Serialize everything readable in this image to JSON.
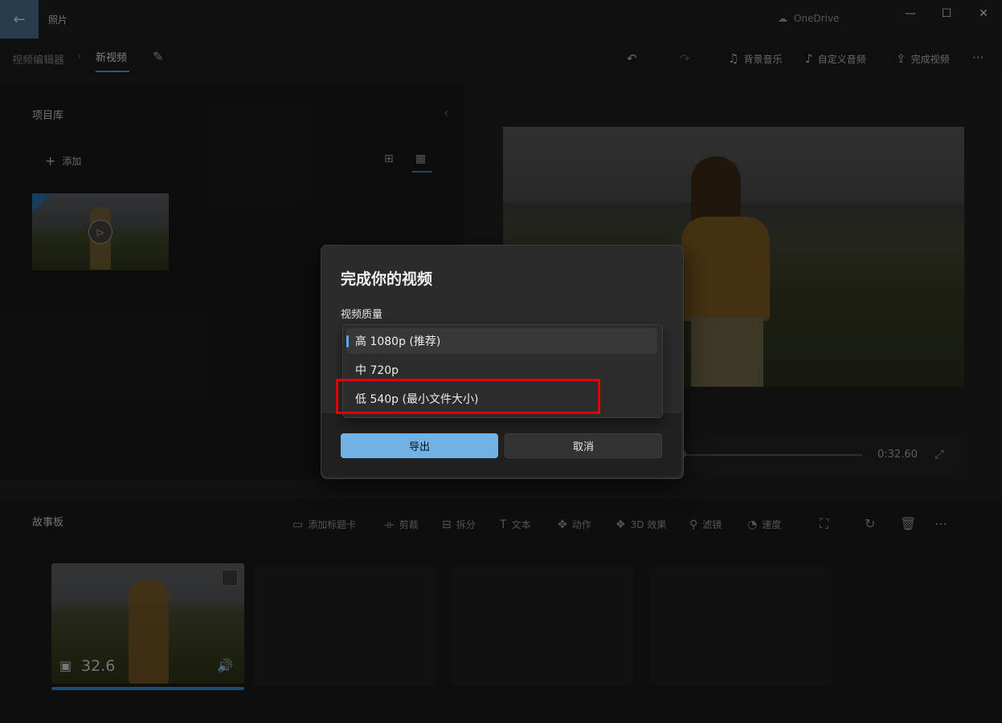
{
  "window": {
    "app_title": "照片",
    "cloud_label": "OneDrive",
    "back_icon": "←",
    "minimize": "—",
    "maximize": "☐",
    "close": "✕"
  },
  "breadcrumb": {
    "root": "视频编辑器",
    "current": "新视频"
  },
  "toolbar": {
    "bg_music": "背景音乐",
    "custom_audio": "自定义音频",
    "finish_video": "完成视频"
  },
  "library": {
    "title": "项目库",
    "add": "添加"
  },
  "player": {
    "time": "0:32.60"
  },
  "storyboard": {
    "title": "故事板",
    "tools": {
      "add_title_card": "添加标题卡",
      "trim": "剪裁",
      "split": "拆分",
      "text": "文本",
      "motion": "动作",
      "effects_3d": "3D 效果",
      "filters": "滤镜",
      "speed": "速度"
    },
    "clip": {
      "duration": "32.6"
    }
  },
  "dialog": {
    "title": "完成你的视频",
    "quality_label": "视频质量",
    "options": [
      {
        "label": "高 1080p (推荐)",
        "selected": true
      },
      {
        "label": "中 720p",
        "selected": false
      },
      {
        "label": "低 540p (最小文件大小)",
        "selected": false
      }
    ],
    "export_label": "导出",
    "cancel_label": "取消"
  },
  "colors": {
    "accent": "#72b1e3",
    "highlight_box": "#e00000"
  }
}
